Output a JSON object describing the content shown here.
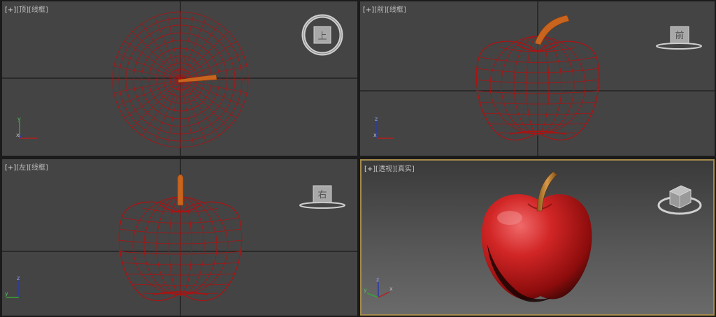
{
  "viewports": {
    "top": {
      "plus": "[+]",
      "view": "[顶]",
      "mode": "[线框]",
      "cube_face": "上"
    },
    "front": {
      "plus": "[+]",
      "view": "[前]",
      "mode": "[线框]",
      "cube_face": "前"
    },
    "left": {
      "plus": "[+]",
      "view": "[左]",
      "mode": "[线框]",
      "cube_face": "右"
    },
    "persp": {
      "plus": "[+]",
      "view": "[透视]",
      "mode": "[真实]",
      "active": true
    }
  },
  "axis_labels": {
    "x": "x",
    "y": "y",
    "z": "z"
  },
  "colors": {
    "viewport_bg": "#444444",
    "wireframe": "#b01010",
    "stem": "#c8641e",
    "active_border": "#a58a4a",
    "apple_red": "#c81e1e"
  }
}
